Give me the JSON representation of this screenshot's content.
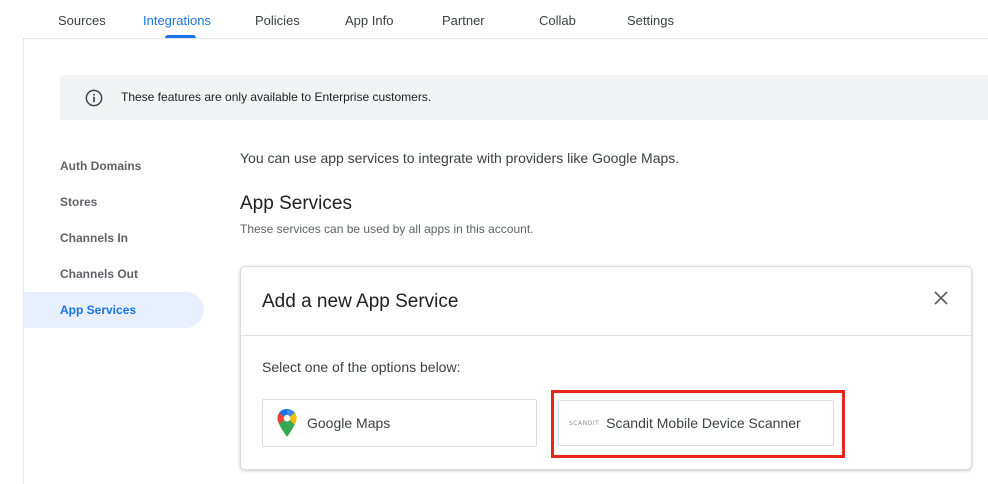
{
  "tabs": [
    {
      "label": "Sources"
    },
    {
      "label": "Integrations",
      "active": true
    },
    {
      "label": "Policies"
    },
    {
      "label": "App Info"
    },
    {
      "label": "Partner"
    },
    {
      "label": "Collab"
    },
    {
      "label": "Settings"
    }
  ],
  "banner": {
    "icon": "info-icon",
    "text": "These features are only available to Enterprise customers."
  },
  "sidebar": {
    "items": [
      {
        "label": "Auth Domains"
      },
      {
        "label": "Stores"
      },
      {
        "label": "Channels In"
      },
      {
        "label": "Channels Out"
      },
      {
        "label": "App Services",
        "active": true
      }
    ]
  },
  "main": {
    "intro": "You can use app services to integrate with providers like Google Maps.",
    "title": "App Services",
    "subtitle": "These services can be used by all apps in this account."
  },
  "dialog": {
    "title": "Add a new App Service",
    "close_icon": "close-icon",
    "prompt": "Select one of the options below:",
    "options": [
      {
        "label": "Google Maps",
        "icon": "google-maps-icon"
      },
      {
        "label": "Scandit Mobile Device Scanner",
        "logo": "SCANDIT",
        "highlighted": true
      }
    ]
  },
  "colors": {
    "accent": "#1a73e8",
    "highlight": "#e8251b",
    "banner_bg": "#f1f3f4",
    "active_nav_bg": "#e8f0fe"
  }
}
